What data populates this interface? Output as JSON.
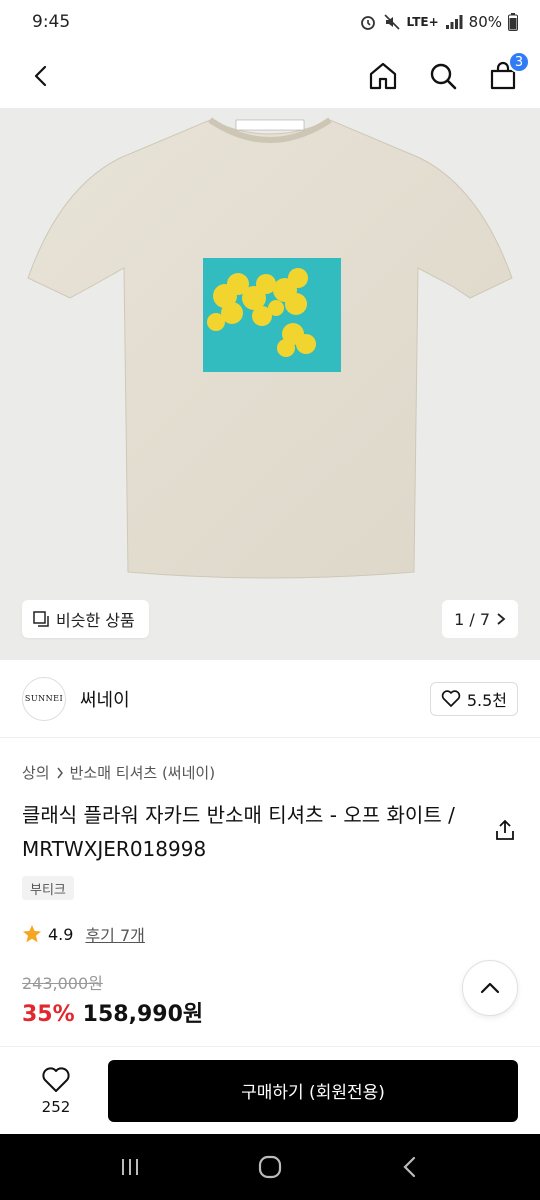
{
  "status": {
    "time": "9:45",
    "network": "LTE+",
    "battery": "80%"
  },
  "header": {
    "cart_count": "3"
  },
  "gallery": {
    "similar_label": "비슷한 상품",
    "page": "1 / 7"
  },
  "brand": {
    "logo_text": "SUNNEI",
    "name": "써네이",
    "likes": "5.5천"
  },
  "breadcrumb": {
    "category": "상의",
    "subcategory": "반소매 티셔츠 (써네이)"
  },
  "product": {
    "title": "클래식 플라워 자카드 반소매 티셔츠 - 오프 화이트 / MRTWXJER018998",
    "tag": "부티크",
    "rating": "4.9",
    "reviews": "후기 7개",
    "original_price": "243,000원",
    "discount": "35%",
    "price": "158,990원"
  },
  "bottom": {
    "wish_count": "252",
    "buy_label": "구매하기 (회원전용)"
  },
  "colors": {
    "accent_badge": "#2f7cf6",
    "discount": "#e0282e",
    "star": "#f5a623"
  }
}
